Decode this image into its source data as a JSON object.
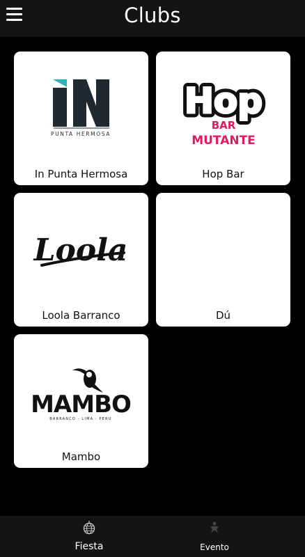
{
  "header": {
    "title": "Clubs",
    "menu_icon": "hamburger-menu-icon"
  },
  "clubs": [
    {
      "name": "In Punta Hermosa",
      "logo": {
        "big_text": "IN",
        "sub_text": "PUNTA HERMOSA",
        "accent": "#2bb3b1",
        "color": "#1f2a30"
      }
    },
    {
      "name": "Hop Bar",
      "logo": {
        "big_text": "Hop",
        "line1": "BAR",
        "line2": "MUTANTE",
        "accent": "#e8185f",
        "color": "#111111"
      }
    },
    {
      "name": "Loola Barranco",
      "logo": {
        "big_text": "Loola",
        "color": "#111111"
      }
    },
    {
      "name": "Dú",
      "logo": null
    },
    {
      "name": "Mambo",
      "logo": {
        "big_text": "MAMBO",
        "sub_text": "BARRANCO · LIMA · PERU",
        "color": "#111111"
      }
    }
  ],
  "bottom_nav": [
    {
      "label": "Fiesta",
      "icon": "disco-ball-icon",
      "active": true
    },
    {
      "label": "Evento",
      "icon": "event-icon",
      "active": false
    }
  ]
}
